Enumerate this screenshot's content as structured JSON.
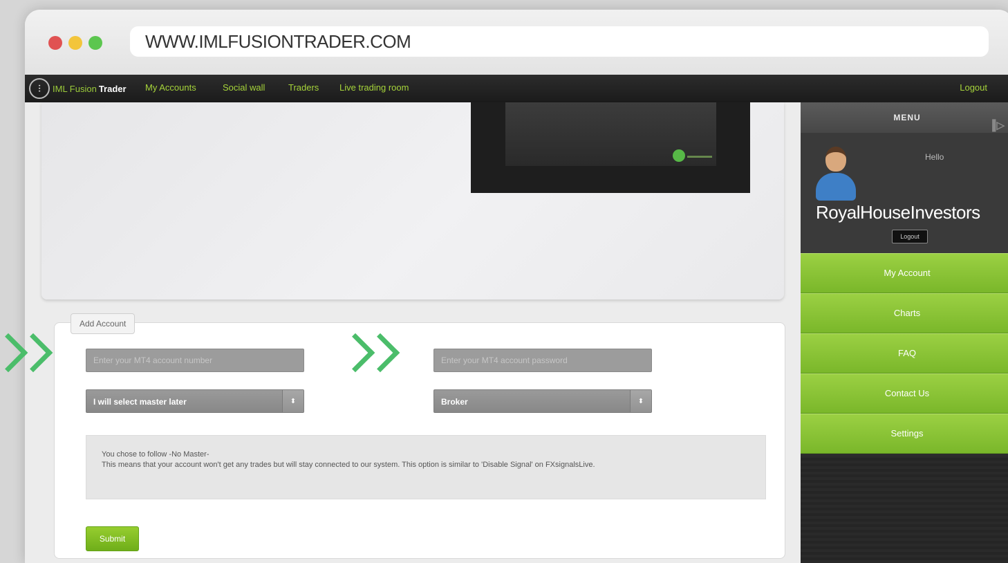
{
  "browser": {
    "url": "WWW.IMLFUSIONTRADER.COM"
  },
  "topnav": {
    "brand_a": "IML Fusion",
    "brand_b": "Trader",
    "links": [
      "My Accounts",
      "Social wall",
      "Traders",
      "Live trading room"
    ],
    "logout": "Logout"
  },
  "form": {
    "legend": "Add Account",
    "account_number_placeholder": "Enter your MT4 account number",
    "account_password_placeholder": "Enter your MT4 account password",
    "master_select": "I will select master later",
    "broker_select": "Broker",
    "notice_line1": "You chose to follow -No Master-",
    "notice_line2": "This means that your account won't get any trades but will stay connected to our system. This option is similar to 'Disable Signal' on FXsignalsLive.",
    "submit_label": "Submit"
  },
  "sidebar": {
    "menu_title": "MENU",
    "hello": "Hello",
    "username": "RoyalHouseInvestors",
    "logout": "Logout",
    "items": [
      "My Account",
      "Charts",
      "FAQ",
      "Contact Us",
      "Settings"
    ]
  }
}
